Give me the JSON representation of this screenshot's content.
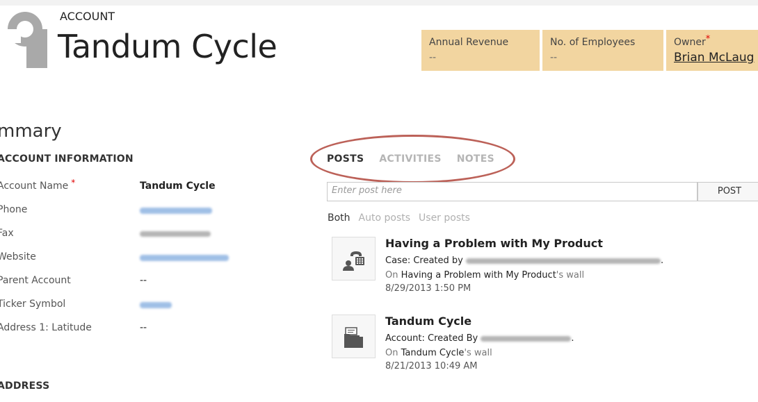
{
  "header": {
    "entity_type": "ACCOUNT",
    "record_name": "Tandum Cycle",
    "tiles": [
      {
        "label": "Annual Revenue",
        "value": "--"
      },
      {
        "label": "No. of Employees",
        "value": "--"
      },
      {
        "label": "Owner",
        "required_mark": "*",
        "value": "Brian McLaug"
      }
    ]
  },
  "summary": {
    "title": "mmary",
    "account_info_header": "ACCOUNT INFORMATION",
    "address_header": "ADDRESS",
    "fields": [
      {
        "label": "Account Name",
        "required_mark": "*",
        "value": "Tandum Cycle"
      },
      {
        "label": "Phone",
        "value": ""
      },
      {
        "label": "Fax",
        "value": ""
      },
      {
        "label": "Website",
        "value": ""
      },
      {
        "label": "Parent Account",
        "value": "--"
      },
      {
        "label": "Ticker Symbol",
        "value": ""
      },
      {
        "label": "Address 1: Latitude",
        "value": "--"
      }
    ]
  },
  "activity": {
    "tabs": [
      "POSTS",
      "ACTIVITIES",
      "NOTES"
    ],
    "active_tab": "POSTS",
    "post_placeholder": "Enter post here",
    "post_button": "POST",
    "filters": [
      "Both",
      "Auto posts",
      "User posts"
    ],
    "active_filter": "Both",
    "feed": [
      {
        "icon": "case-phone-icon",
        "title": "Having a Problem with My Product",
        "created_prefix": "Case: Created by",
        "created_suffix": ".",
        "wall_prefix": "On",
        "wall_name": "Having a Problem with My Product",
        "wall_suffix": "'s wall",
        "timestamp": "8/29/2013 1:50 PM"
      },
      {
        "icon": "account-folder-icon",
        "title": "Tandum Cycle",
        "created_prefix": "Account: Created By",
        "created_suffix": ".",
        "wall_prefix": "On",
        "wall_name": "Tandum Cycle",
        "wall_suffix": "'s wall",
        "timestamp": "8/21/2013 10:49 AM"
      }
    ]
  },
  "colors": {
    "tile_background": "#f2d5a0",
    "required": "#e00000",
    "highlight_ring": "#b0453b"
  }
}
